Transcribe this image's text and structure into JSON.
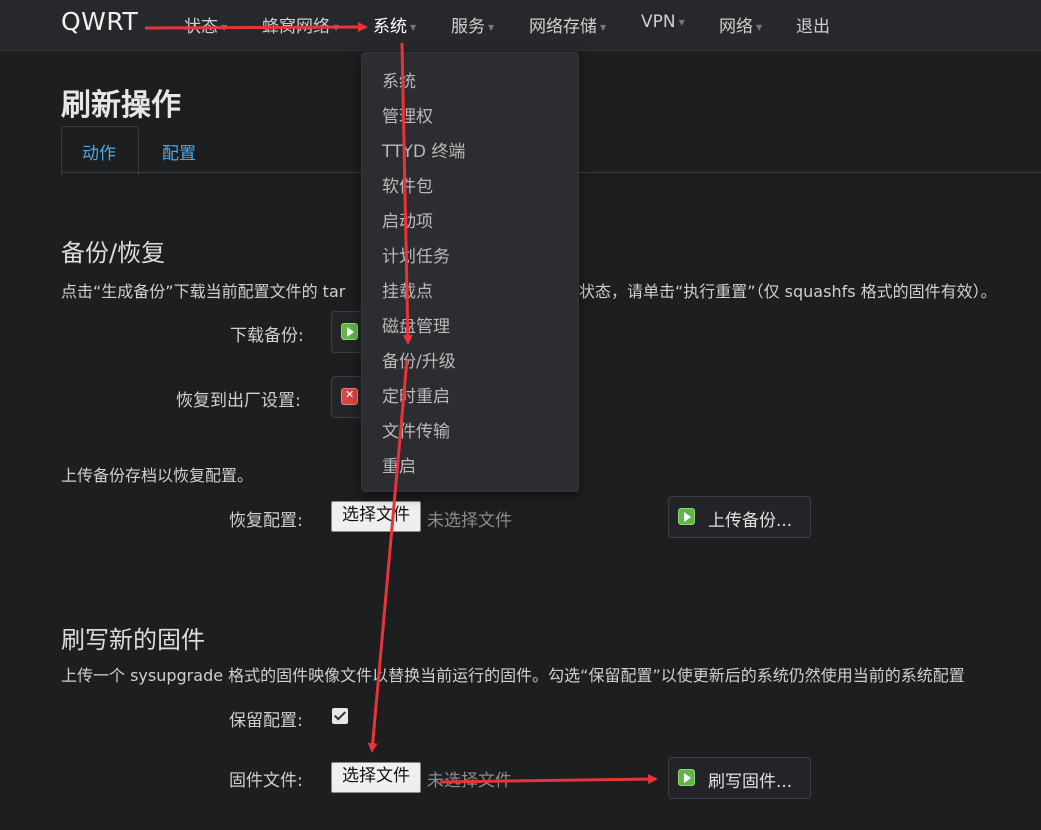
{
  "navbar": {
    "brand": "QWRT",
    "items": [
      {
        "label": "状态"
      },
      {
        "label": "蜂窝网络"
      },
      {
        "label": "系统"
      },
      {
        "label": "服务"
      },
      {
        "label": "网络存储"
      },
      {
        "label": "VPN"
      },
      {
        "label": "网络"
      },
      {
        "label": "退出"
      }
    ]
  },
  "dropdown": {
    "items": [
      "系统",
      "管理权",
      "TTYD 终端",
      "软件包",
      "启动项",
      "计划任务",
      "挂载点",
      "磁盘管理",
      "备份/升级",
      "定时重启",
      "文件传输",
      "重启"
    ]
  },
  "page": {
    "title": "刷新操作",
    "tabs": [
      "动作",
      "配置"
    ]
  },
  "backup": {
    "title": "备份/恢复",
    "desc_left": "点击“生成备份”下载当前配置文件的 tar",
    "desc_right": "状态，请单击“执行重置”（仅 squashfs 格式的固件有效）。",
    "download_label": "下载备份:",
    "reset_label": "恢复到出厂设置:",
    "upload_desc": "上传备份存档以恢复配置。",
    "restore_label": "恢复配置:",
    "choose_file": "选择文件",
    "no_file": "未选择文件",
    "upload_button": "上传备份..."
  },
  "flash": {
    "title": "刷写新的固件",
    "desc": "上传一个 sysupgrade 格式的固件映像文件以替换当前运行的固件。勾选“保留配置”以使更新后的系统仍然使用当前的系统配置",
    "keep_label": "保留配置:",
    "keep_checked": true,
    "firmware_label": "固件文件:",
    "choose_file": "选择文件",
    "no_file": "未选择文件",
    "flash_button": "刷写固件..."
  },
  "colors": {
    "background": "#1d1e20",
    "navbar": "#26282b",
    "tab_active_text": "#4aa8ec",
    "annotation_arrow": "#e8333a"
  }
}
